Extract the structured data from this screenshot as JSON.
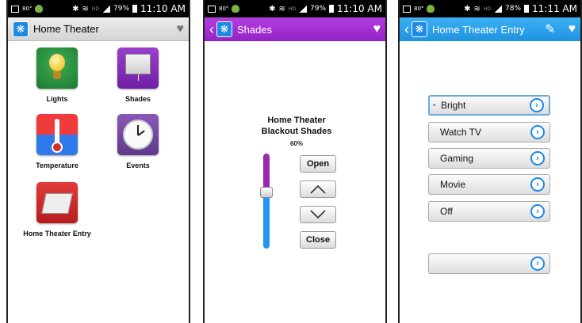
{
  "status_bars": [
    {
      "temp": "80°",
      "battery": "79%",
      "time": "11:10 AM"
    },
    {
      "temp": "80°",
      "battery": "79%",
      "time": "11:10 AM"
    },
    {
      "temp": "80°",
      "battery": "78%",
      "time": "11:11 AM"
    }
  ],
  "status_icons": {
    "bluetooth": "bluetooth-icon",
    "wifi": "wifi-icon",
    "hd": "HD",
    "signal": "signal-icon"
  },
  "screen1": {
    "title": "Home Theater",
    "tiles": [
      {
        "label": "Lights",
        "icon": "lightbulb-icon"
      },
      {
        "label": "Shades",
        "icon": "shade-icon"
      },
      {
        "label": "Temperature",
        "icon": "thermometer-icon"
      },
      {
        "label": "Events",
        "icon": "clock-icon"
      },
      {
        "label": "Home Theater Entry",
        "icon": "keypad-icon"
      }
    ]
  },
  "screen2": {
    "title": "Shades",
    "device_title_line1": "Home Theater",
    "device_title_line2": "Blackout Shades",
    "level": "60%",
    "level_value": 0.6,
    "buttons": {
      "open": "Open",
      "close": "Close",
      "up": "up-arrow-icon",
      "down": "down-arrow-icon"
    }
  },
  "screen3": {
    "title": "Home Theater Entry",
    "scenes": [
      {
        "label": "Bright",
        "selected": true
      },
      {
        "label": "Watch TV",
        "selected": false
      },
      {
        "label": "Gaming",
        "selected": false
      },
      {
        "label": "Movie",
        "selected": false
      },
      {
        "label": "Off",
        "selected": false
      },
      {
        "label": "",
        "selected": false
      }
    ]
  },
  "colors": {
    "purple_header": "#9c27b0",
    "blue_header": "#2196f3",
    "slider_top": "#9c27b0",
    "slider_bottom": "#2196f3"
  }
}
